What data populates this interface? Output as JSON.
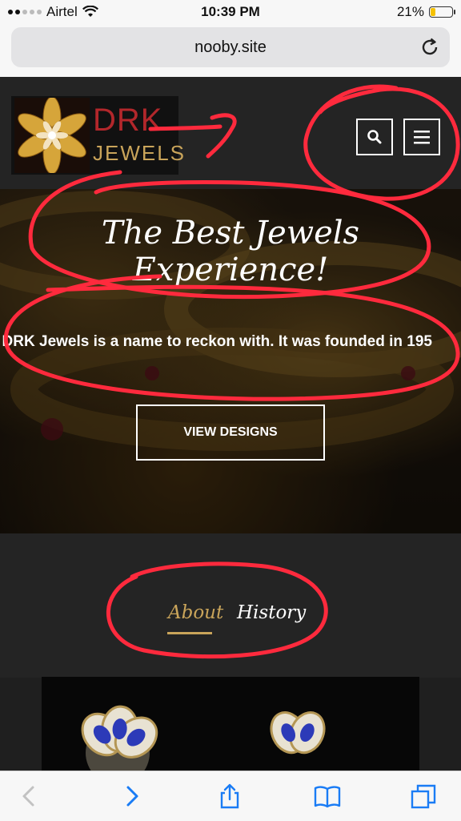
{
  "status": {
    "carrier": "Airtel",
    "time": "10:39 PM",
    "battery": "21%",
    "battery_level": 0.21
  },
  "browser": {
    "url": "nooby.site"
  },
  "site": {
    "logo": {
      "line1": "DRK",
      "line2": "JEWELS"
    },
    "hero": {
      "title": "The Best Jewels Experience!",
      "intro": ", DRK Jewels is a name to reckon with. It was founded in 195",
      "cta": "VIEW DESIGNS"
    },
    "tabs": [
      {
        "label": "About",
        "active": true
      },
      {
        "label": "History",
        "active": false
      }
    ]
  },
  "colors": {
    "accent_gold": "#c9a45a",
    "brand_red": "#b2272b",
    "annotation_red": "#ff2a3d",
    "ios_blue": "#1a7cf5"
  },
  "icons": [
    "wifi-icon",
    "reload-icon",
    "search-icon",
    "menu-icon",
    "back-icon",
    "forward-icon",
    "share-icon",
    "bookmarks-icon",
    "tabs-icon"
  ]
}
